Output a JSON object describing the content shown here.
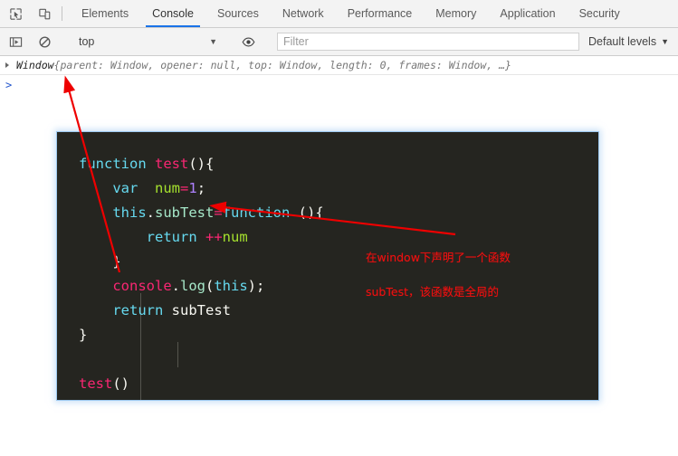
{
  "toolbar": {
    "inspect_icon": "inspect-element-icon",
    "device_icon": "device-toolbar-icon",
    "tabs": [
      {
        "label": "Elements",
        "active": false
      },
      {
        "label": "Console",
        "active": true
      },
      {
        "label": "Sources",
        "active": false
      },
      {
        "label": "Network",
        "active": false
      },
      {
        "label": "Performance",
        "active": false
      },
      {
        "label": "Memory",
        "active": false
      },
      {
        "label": "Application",
        "active": false
      },
      {
        "label": "Security",
        "active": false
      }
    ]
  },
  "filterbar": {
    "sidebar_icon": "console-sidebar-icon",
    "clear_icon": "clear-console-icon",
    "context_value": "top",
    "context_caret": "▼",
    "eye_icon": "eye-icon",
    "filter_placeholder": "Filter",
    "filter_value": "",
    "levels_label": "Default levels",
    "levels_caret": "▼"
  },
  "console": {
    "disclosure_icon": "expand-triangle-icon",
    "output_name": "Window",
    "output_body": " {parent: Window, opener: null, top: Window, length: 0, frames: Window, …}",
    "prompt_caret": ">",
    "prompt_value": ""
  },
  "code_block": {
    "language": "javascript",
    "background": "#252520",
    "border_color": "#9ec9f0",
    "lines": [
      "function test(){",
      "    var  num=1;",
      "    this.subTest=function (){",
      "        return ++num",
      "    }",
      "    console.log(this);",
      "    return subTest",
      "}",
      "",
      "test()"
    ],
    "tokens": {
      "function_kw": "function",
      "test_name": "test",
      "var_kw": "var",
      "num_var": "num",
      "one": "1",
      "this_kw": "this",
      "subtest_prop": "subTest",
      "return_kw": "return",
      "increment": "++",
      "console_obj": "console",
      "log_method": "log",
      "subtest_ref": "subTest",
      "call_test": "test"
    }
  },
  "annotations": {
    "color": "#ee1111",
    "note_line1": "在window下声明了一个函数",
    "note_line2": "subTest，该函数是全局的",
    "arrow1_name": "arrow-to-window-output",
    "arrow2_name": "arrow-to-subtest"
  }
}
